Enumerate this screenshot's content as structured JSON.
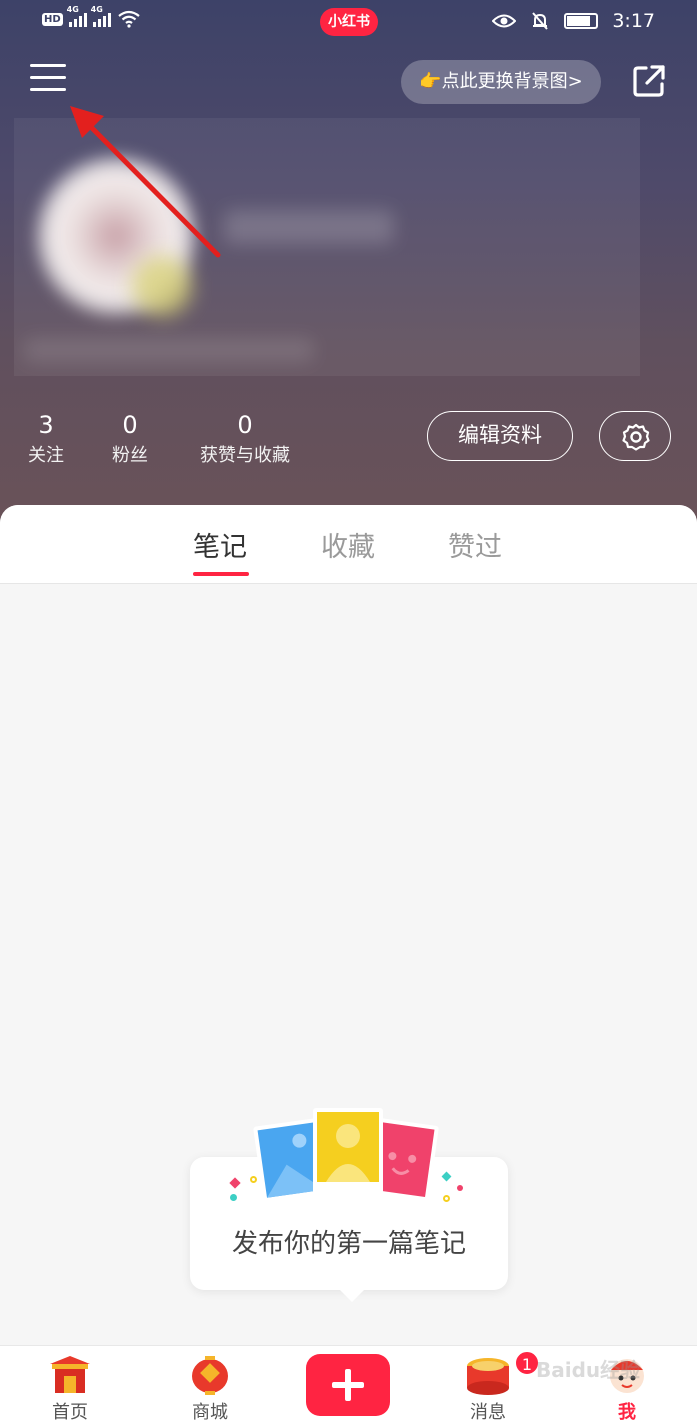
{
  "status_bar": {
    "hd_label": "HD",
    "net_1": "4G",
    "net_2": "4G",
    "app_pill": "小红书",
    "time": "3:17"
  },
  "header": {
    "change_bg_label": "👉点此更换背景图>"
  },
  "stats": [
    {
      "count": "3",
      "label": "关注"
    },
    {
      "count": "0",
      "label": "粉丝"
    },
    {
      "count": "0",
      "label": "获赞与收藏"
    }
  ],
  "edit_profile_label": "编辑资料",
  "tabs": [
    {
      "label": "笔记",
      "active": true
    },
    {
      "label": "收藏",
      "active": false
    },
    {
      "label": "赞过",
      "active": false
    }
  ],
  "empty_state": {
    "text": "发布你的第一篇笔记"
  },
  "bottom_nav": [
    {
      "label": "首页",
      "icon": "temple-gate-icon"
    },
    {
      "label": "商城",
      "icon": "lantern-icon"
    },
    {
      "label": "",
      "icon": "plus-icon"
    },
    {
      "label": "消息",
      "icon": "drum-icon",
      "badge": "1"
    },
    {
      "label": "我",
      "icon": "mascot-icon",
      "active": true
    }
  ],
  "watermark": "Baidu经验",
  "colors": {
    "accent": "#ff2442",
    "header_top": "#3d4268",
    "header_bottom": "#6a5258"
  }
}
